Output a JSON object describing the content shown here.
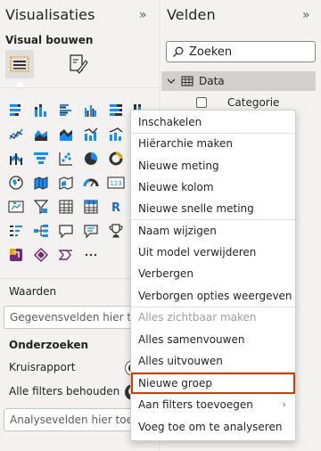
{
  "viz_pane": {
    "title": "Visualisaties",
    "collapse_glyph": "»",
    "subtitle": "Visual bouwen"
  },
  "wells": {
    "values_label": "Waarden",
    "values_placeholder": "Gegevensvelden hier toevoegen",
    "drill_label": "Onderzoeken",
    "cross_report_label": "Kruisrapport",
    "cross_report_state": "off",
    "keep_filters_label": "Alle filters behouden",
    "keep_filters_state": "on",
    "drill_placeholder": "Analysevelden hier toevoegen"
  },
  "fields_pane": {
    "title": "Velden",
    "collapse_glyph": "»",
    "search_placeholder": "Zoeken",
    "table_name": "Data",
    "field_name": "Categorie"
  },
  "menu_items": [
    {
      "label": "Inschakelen"
    },
    {
      "label": "Hiërarchie maken"
    },
    {
      "label": "Nieuwe meting"
    },
    {
      "label": "Nieuwe kolom"
    },
    {
      "label": "Nieuwe snelle meting"
    },
    {
      "label": "Naam wijzigen"
    },
    {
      "label": "Uit model verwijderen"
    },
    {
      "label": "Verbergen"
    },
    {
      "label": "Verborgen opties weergeven"
    },
    {
      "label": "Alles zichtbaar maken",
      "disabled": true
    },
    {
      "label": "Alles samenvouwen"
    },
    {
      "label": "Alles uitvouwen"
    },
    {
      "label": "Nieuwe groep",
      "highlighted": true
    },
    {
      "label": "Aan filters toevoegen",
      "submenu": true
    },
    {
      "label": "Voeg toe om te analyseren"
    }
  ],
  "visual_icons": [
    "stacked-bar-icon",
    "stacked-column-icon",
    "clustered-bar-icon",
    "clustered-column-icon",
    "100-stacked-bar-icon",
    "100-stacked-column-icon",
    "line-chart-icon",
    "area-chart-icon",
    "stacked-area-icon",
    "line-clustered-column-icon",
    "line-stacked-column-icon",
    "ribbon-chart-icon",
    "funnel-icon",
    "scatter-icon",
    "pie-icon",
    "donut-icon",
    "treemap-icon",
    "map-icon",
    "filled-map-icon",
    "shape-map-icon",
    "gauge-icon",
    "card-icon",
    "multirow-card-icon",
    "kpi-icon",
    "slicer-icon",
    "table-icon",
    "matrix-icon",
    "r-visual-icon",
    "python-icon",
    "key-influencers-icon",
    "decomposition-tree-icon",
    "qa-icon",
    "smart-narrative-icon",
    "trophy-icon",
    "paginated-report-icon",
    "power-apps-icon",
    "power-automate-icon",
    "get-more-visuals-icon",
    "more-options-icon"
  ],
  "colors": {
    "accent": "#118dff",
    "highlight_border": "#d83b01",
    "pane_bg": "#f3f2f1"
  }
}
